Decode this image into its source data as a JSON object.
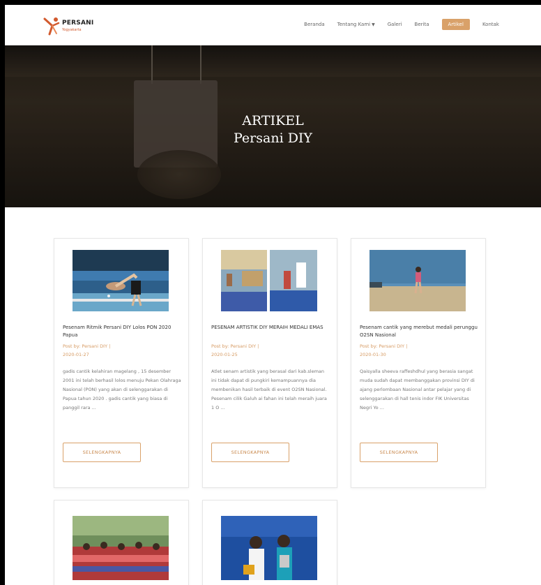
{
  "brand": {
    "name": "PERSANI",
    "sub": "Yogyakarta"
  },
  "nav": [
    {
      "label": "Beranda",
      "active": false
    },
    {
      "label": "Tentang Kami",
      "active": false,
      "dropdown": true
    },
    {
      "label": "Galeri",
      "active": false
    },
    {
      "label": "Berita",
      "active": false
    },
    {
      "label": "Artikel",
      "active": true
    },
    {
      "label": "Kontak",
      "active": false
    }
  ],
  "hero": {
    "line1": "ARTIKEL",
    "line2": "Persani DIY"
  },
  "articles": [
    {
      "title": "Pesenam Ritmik Persani DIY Lolos PON 2020 Papua",
      "author": "Post by: Persani DIY |",
      "date": "2020-01-27",
      "excerpt": "gadis cantik kelahiran magelang , 15 desember 2001 ini telah berhasil lolos menuju Pekan Olahraga Nasional (PON) yang akan di selenggarakan di Papua tahun 2020 . gadis cantik yang biasa di panggil rara ...",
      "button": "SELENGKAPNYA"
    },
    {
      "title": "PESENAM ARTISTIK DIY MERAIH MEDALI EMAS",
      "author": "Post by: Persani DIY |",
      "date": "2020-01-25",
      "excerpt": "Atlet senam artistik yang berasal dari kab.sleman ini tidak dapat di pungkiri kemampuannya dia membenikan hasil terbaik di event O2SN Nasional. Pesenam cilik Galuh ai fahan ini telah meraih juara 1 O ...",
      "button": "SELENGKAPNYA"
    },
    {
      "title": "Pesenam cantik yang merebut medali perunggu O2SN Nasional",
      "author": "Post by: Persani DIY |",
      "date": "2020-01-30",
      "excerpt": "Qaisyalla sheeva raffeshdhul yang berasia sangat muda sudah dapat membanggakan provinsi DIY di ajang perlombaan Nasional antar pelajar yang di selenggarakan di hall tenis indor FIK Universitas Negri Yo ...",
      "button": "SELENGKAPNYA"
    },
    {
      "title": "",
      "author": "",
      "date": "",
      "excerpt": "",
      "button": ""
    },
    {
      "title": "",
      "author": "",
      "date": "",
      "excerpt": "",
      "button": ""
    }
  ]
}
